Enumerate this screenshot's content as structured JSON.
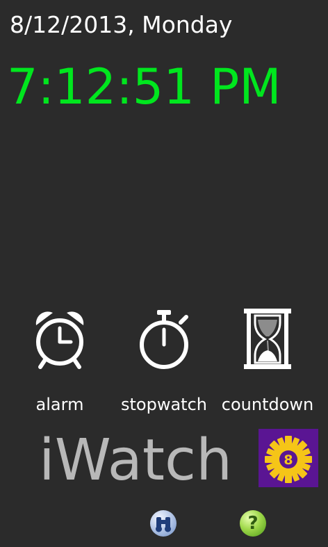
{
  "header": {
    "date": "8/12/2013, Monday",
    "time": "7:12:51 PM"
  },
  "tiles": [
    {
      "label": "alarm",
      "icon": "alarm-clock-icon"
    },
    {
      "label": "stopwatch",
      "icon": "stopwatch-icon"
    },
    {
      "label": "countdown",
      "icon": "hourglass-icon"
    }
  ],
  "app": {
    "name": "iWatch",
    "badge_text": "8",
    "badge_icon": "gear-badge-icon"
  },
  "footer": {
    "about_icon": "binoculars-icon",
    "help_symbol": "?",
    "help_icon": "help-icon"
  },
  "colors": {
    "background": "#2b2b2b",
    "time": "#00e61e",
    "logo": "#b8b8b8",
    "badge_bg": "#5a1593",
    "gear": "#f5c518"
  }
}
